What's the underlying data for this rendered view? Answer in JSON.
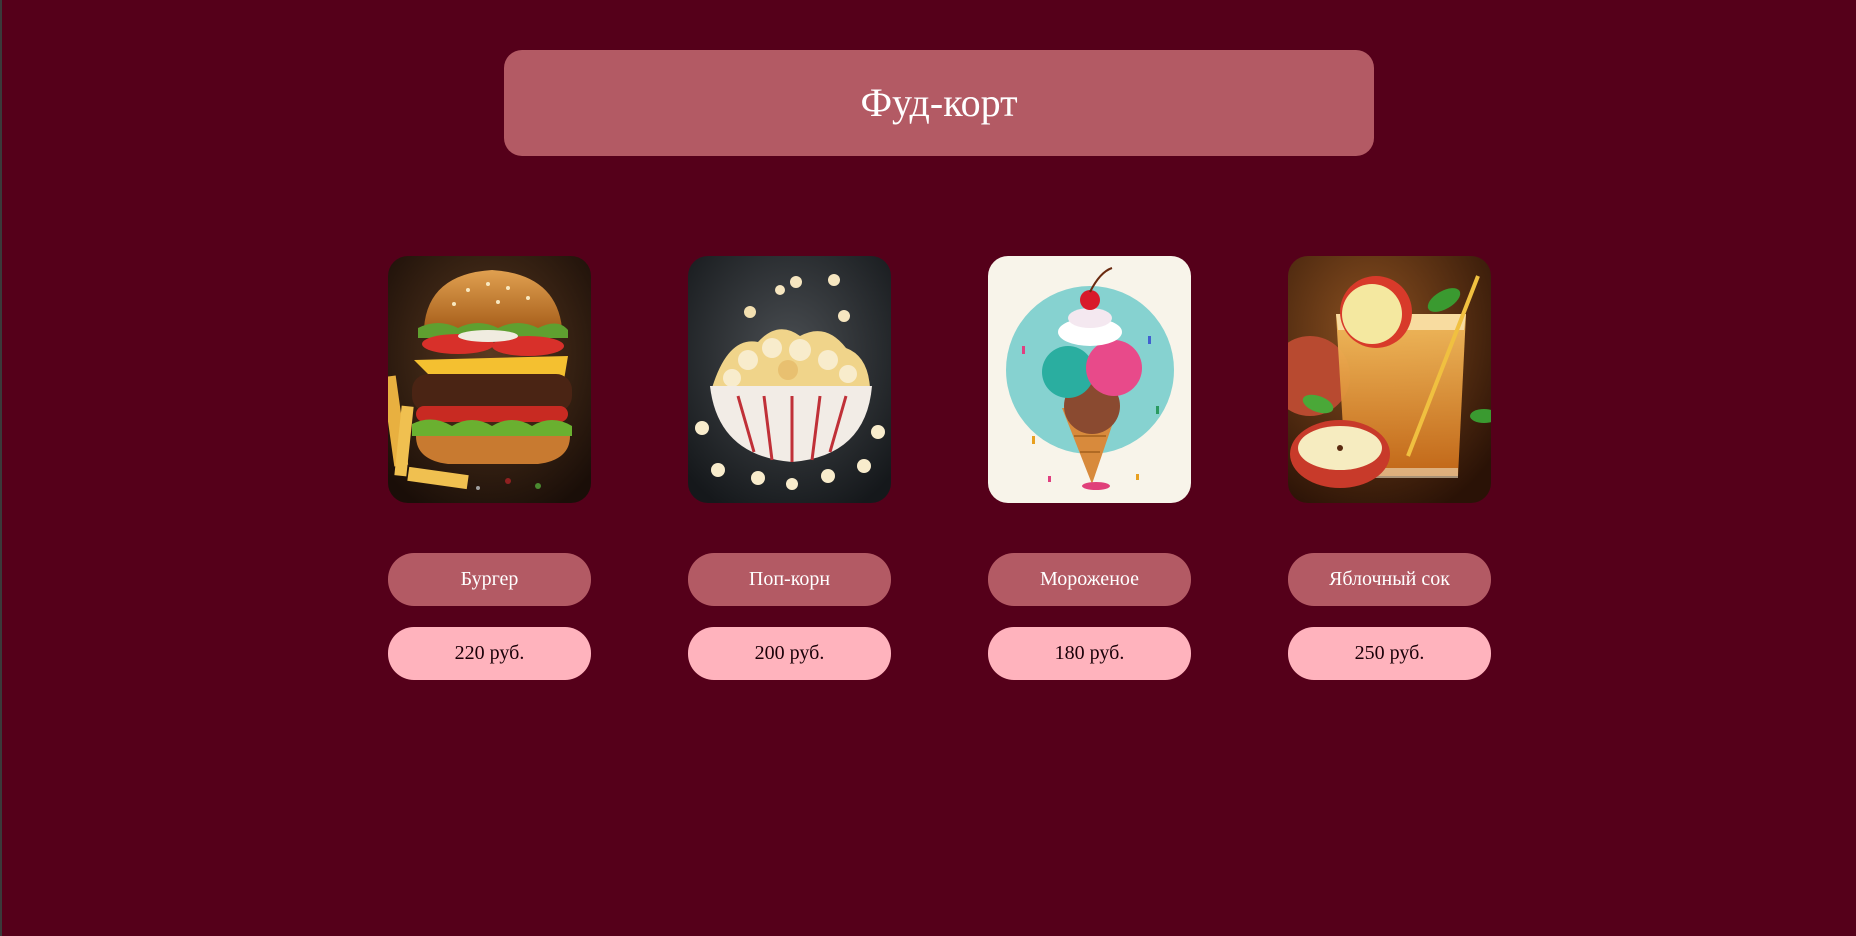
{
  "header": {
    "title": "Фуд-корт"
  },
  "colors": {
    "background": "#55001a",
    "header": "#b35a64",
    "name_button": "#b35a64",
    "price_button": "#ffb3bd"
  },
  "products": [
    {
      "name": "Бургер",
      "price": "220 руб.",
      "image_icon": "burger-photo"
    },
    {
      "name": "Поп-корн",
      "price": "200 руб.",
      "image_icon": "popcorn-photo"
    },
    {
      "name": "Мороженое",
      "price": "180 руб.",
      "image_icon": "ice-cream-photo"
    },
    {
      "name": "Яблочный сок",
      "price": "250 руб.",
      "image_icon": "apple-juice-photo"
    }
  ]
}
